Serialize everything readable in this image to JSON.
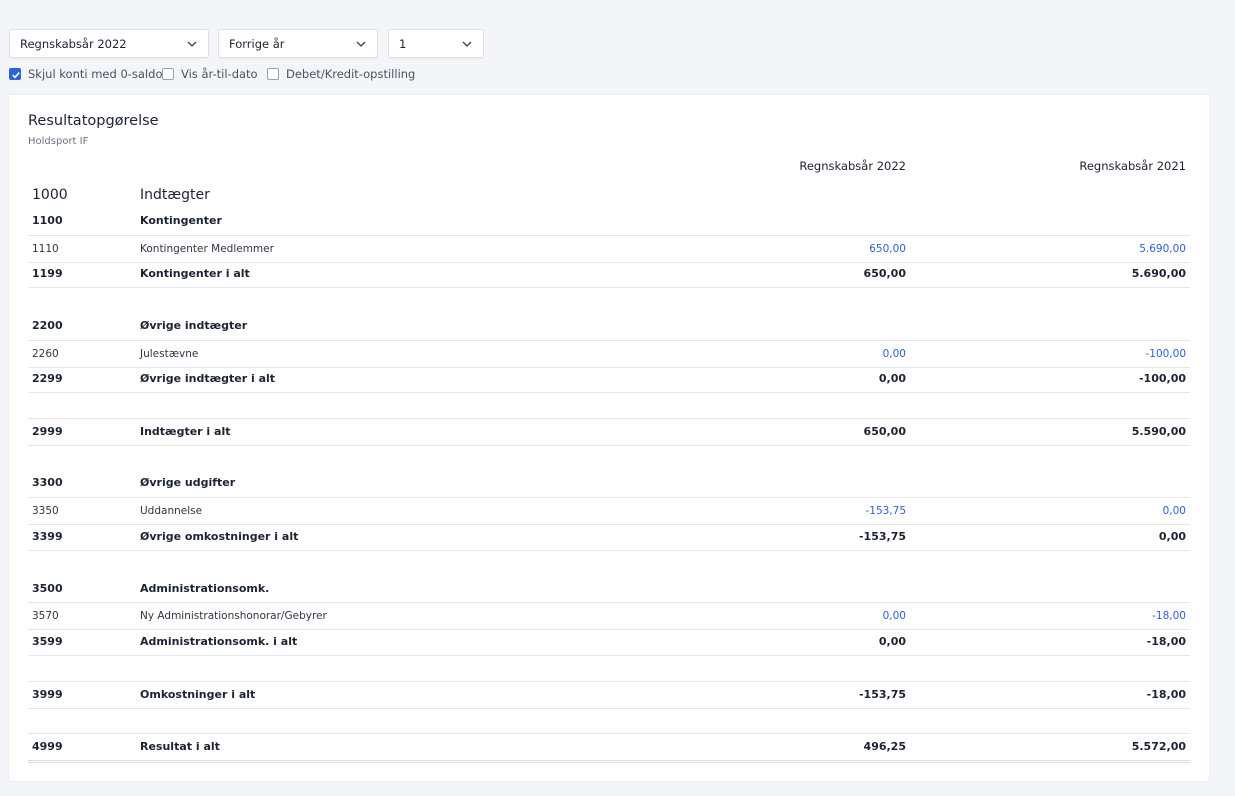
{
  "filters": {
    "period": "Regnskabsår 2022",
    "compare": "Forrige år",
    "level": "1"
  },
  "options": [
    {
      "label": "Skjul konti med 0-saldo",
      "checked": true
    },
    {
      "label": "Vis år-til-dato",
      "checked": false
    },
    {
      "label": "Debet/Kredit-opstilling",
      "checked": false
    }
  ],
  "report": {
    "title": "Resultatopgørelse",
    "subtitle": "Holdsport IF",
    "columns": [
      "Regnskabsår 2022",
      "Regnskabsår 2021"
    ],
    "rows": [
      {
        "type": "head1",
        "num": "1000",
        "name": "Indtægter",
        "v1": "",
        "v2": ""
      },
      {
        "type": "head2",
        "num": "1100",
        "name": "Kontingenter",
        "v1": "",
        "v2": ""
      },
      {
        "type": "detail",
        "num": "1110",
        "name": "Kontingenter Medlemmer",
        "v1": "650,00",
        "v2": "5.690,00"
      },
      {
        "type": "total",
        "num": "1199",
        "name": "Kontingenter i alt",
        "v1": "650,00",
        "v2": "5.690,00"
      },
      {
        "type": "head2",
        "num": "2200",
        "name": "Øvrige indtægter",
        "v1": "",
        "v2": ""
      },
      {
        "type": "detail",
        "num": "2260",
        "name": "Julestævne",
        "v1": "0,00",
        "v2": "-100,00"
      },
      {
        "type": "total",
        "num": "2299",
        "name": "Øvrige indtægter i alt",
        "v1": "0,00",
        "v2": "-100,00"
      },
      {
        "type": "total",
        "num": "2999",
        "name": "Indtægter i alt",
        "v1": "650,00",
        "v2": "5.590,00"
      },
      {
        "type": "head2",
        "num": "3300",
        "name": "Øvrige udgifter",
        "v1": "",
        "v2": ""
      },
      {
        "type": "detail",
        "num": "3350",
        "name": "Uddannelse",
        "v1": "-153,75",
        "v2": "0,00"
      },
      {
        "type": "total",
        "num": "3399",
        "name": "Øvrige omkostninger i alt",
        "v1": "-153,75",
        "v2": "0,00"
      },
      {
        "type": "head2",
        "num": "3500",
        "name": "Administrationsomk.",
        "v1": "",
        "v2": ""
      },
      {
        "type": "detail",
        "num": "3570",
        "name": "Ny Administrationshonorar/Gebyrer",
        "v1": "0,00",
        "v2": "-18,00"
      },
      {
        "type": "total",
        "num": "3599",
        "name": "Administrationsomk. i alt",
        "v1": "0,00",
        "v2": "-18,00"
      },
      {
        "type": "total",
        "num": "3999",
        "name": "Omkostninger i alt",
        "v1": "-153,75",
        "v2": "-18,00"
      },
      {
        "type": "total",
        "num": "4999",
        "name": "Resultat i alt",
        "v1": "496,25",
        "v2": "5.572,00"
      }
    ]
  },
  "colors": {
    "accent": "#2e63d8",
    "text": "#1c2333",
    "background": "#f4f5f8"
  }
}
